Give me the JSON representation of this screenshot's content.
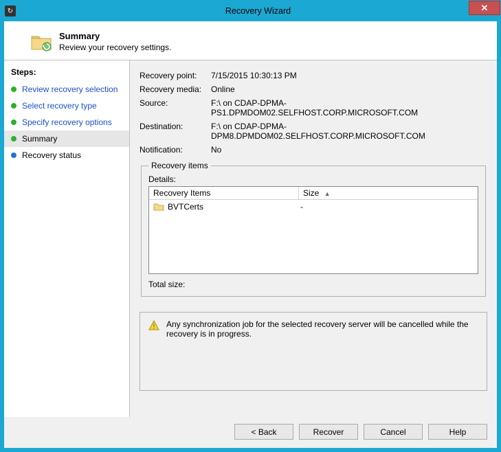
{
  "window": {
    "title": "Recovery Wizard"
  },
  "header": {
    "title": "Summary",
    "subtitle": "Review your recovery settings."
  },
  "sidebar": {
    "title": "Steps:",
    "items": [
      {
        "label": "Review recovery selection",
        "state": "done-link"
      },
      {
        "label": "Select recovery type",
        "state": "done-link"
      },
      {
        "label": "Specify recovery options",
        "state": "done-link"
      },
      {
        "label": "Summary",
        "state": "current"
      },
      {
        "label": "Recovery status",
        "state": "future"
      }
    ]
  },
  "details": {
    "recovery_point_label": "Recovery point:",
    "recovery_point_value": "7/15/2015 10:30:13 PM",
    "recovery_media_label": "Recovery media:",
    "recovery_media_value": "Online",
    "source_label": "Source:",
    "source_value": "F:\\ on CDAP-DPMA-PS1.DPMDOM02.SELFHOST.CORP.MICROSOFT.COM",
    "destination_label": "Destination:",
    "destination_value": "F:\\ on CDAP-DPMA-DPM8.DPMDOM02.SELFHOST.CORP.MICROSOFT.COM",
    "notification_label": "Notification:",
    "notification_value": "No"
  },
  "recovery_items": {
    "legend": "Recovery items",
    "details_label": "Details:",
    "columns": {
      "items": "Recovery Items",
      "size": "Size"
    },
    "rows": [
      {
        "name": "BVTCerts",
        "size": "-"
      }
    ],
    "total_label": "Total size:",
    "total_value": ""
  },
  "warning": {
    "text": "Any synchronization job for the selected recovery server will be cancelled while the recovery is in progress."
  },
  "buttons": {
    "back": "< Back",
    "recover": "Recover",
    "cancel": "Cancel",
    "help": "Help"
  }
}
